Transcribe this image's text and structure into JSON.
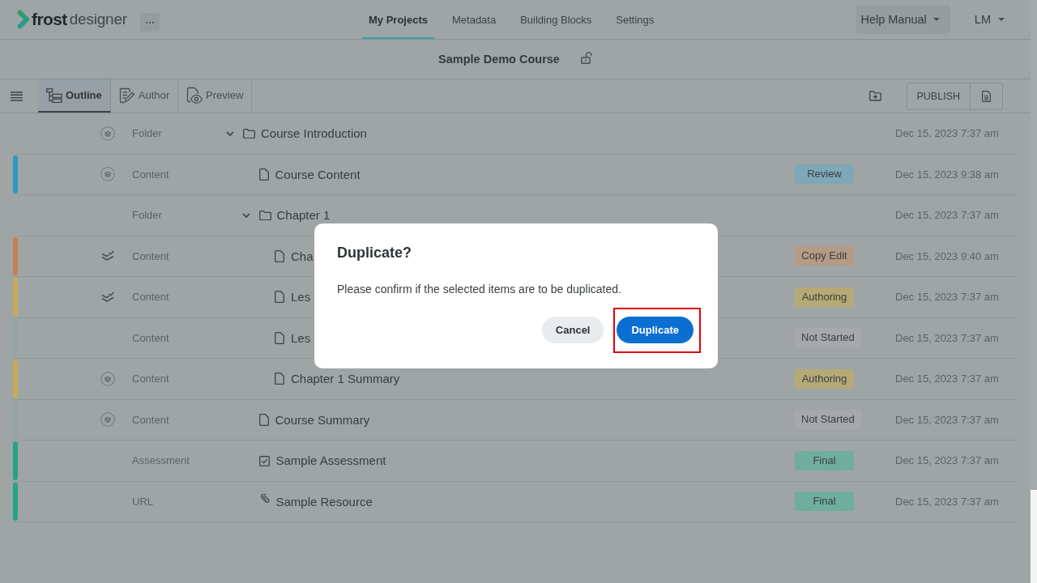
{
  "header": {
    "logo": {
      "brand": "frost",
      "product": "designer"
    },
    "nav": [
      {
        "label": "My Projects",
        "selected": true
      },
      {
        "label": "Metadata",
        "selected": false
      },
      {
        "label": "Building Blocks",
        "selected": false
      },
      {
        "label": "Settings",
        "selected": false
      }
    ],
    "help_menu": {
      "label": "Help Manual"
    },
    "user_menu": {
      "label": "LM"
    }
  },
  "course": {
    "title": "Sample Demo Course",
    "locked": false
  },
  "toolbar": {
    "tabs": [
      {
        "label": "Outline",
        "kind": "outline",
        "selected": true
      },
      {
        "label": "Author",
        "kind": "author",
        "selected": false
      },
      {
        "label": "Preview",
        "kind": "preview",
        "selected": false
      }
    ],
    "publish": {
      "label": "PUBLISH"
    }
  },
  "outline": {
    "rows": [
      {
        "type": "Folder",
        "title": "Course Introduction",
        "kind": "folder",
        "expanded": true,
        "layers": {
          "kind": "ring"
        },
        "date": "Dec 15, 2023 7:37 am",
        "children": [
          {
            "type": "Content",
            "title": "Course Content",
            "kind": "page",
            "layers": {
              "kind": "ring"
            },
            "color": "#2d98c2",
            "status": {
              "label": "Review",
              "color": "#7ea7b8"
            },
            "date": "Dec 15, 2023 9:38 am"
          },
          {
            "type": "Folder",
            "title": "Chapter 1",
            "kind": "folder",
            "expanded": true,
            "date": "Dec 15, 2023 7:37 am",
            "children": [
              {
                "type": "Content",
                "title": "Cha",
                "kind": "page",
                "layers": {
                  "kind": "check"
                },
                "color": "#c4814c",
                "status": {
                  "label": "Copy Edit",
                  "color": "#b59a86"
                },
                "date": "Dec 15, 2023 9:40 am"
              },
              {
                "type": "Content",
                "title": "Les",
                "kind": "page",
                "layers": {
                  "kind": "check"
                },
                "color": "#c6ab57",
                "status": {
                  "label": "Authoring",
                  "color": "#b5aa76"
                },
                "date": "Dec 15, 2023 7:37 am"
              },
              {
                "type": "Content",
                "title": "Les",
                "kind": "page",
                "color": "#95a3a6",
                "status": {
                  "label": "Not Started",
                  "color": "#a5a9a9"
                },
                "date": "Dec 15, 2023 7:37 am"
              },
              {
                "type": "Content",
                "title": "Chapter 1 Summary",
                "kind": "page",
                "layers": {
                  "kind": "ring"
                },
                "color": "#c6ab57",
                "status": {
                  "label": "Authoring",
                  "color": "#b5aa76"
                },
                "date": "Dec 15, 2023 7:37 am"
              }
            ]
          },
          {
            "type": "Content",
            "title": "Course Summary",
            "kind": "page",
            "layers": {
              "kind": "ring"
            },
            "color": "#95a3a6",
            "status": {
              "label": "Not Started",
              "color": "#a5a9a9"
            },
            "date": "Dec 15, 2023 7:37 am"
          },
          {
            "type": "Assessment",
            "title": "Sample Assessment",
            "kind": "assessment",
            "color": "#23a487",
            "status": {
              "label": "Final",
              "color": "#6fae9e"
            },
            "date": "Dec 15, 2023 7:37 am"
          },
          {
            "type": "URL",
            "title": "Sample Resource",
            "kind": "link",
            "color": "#23a487",
            "status": {
              "label": "Final",
              "color": "#6fae9e"
            },
            "date": "Dec 15, 2023 7:37 am"
          }
        ]
      }
    ]
  },
  "dialog": {
    "title": "Duplicate?",
    "message": "Please confirm if the selected items are to be duplicated.",
    "buttons": [
      {
        "label": "Cancel",
        "kind": "secondary",
        "highlighted": false
      },
      {
        "label": "Duplicate",
        "kind": "primary",
        "highlighted": true
      }
    ]
  }
}
